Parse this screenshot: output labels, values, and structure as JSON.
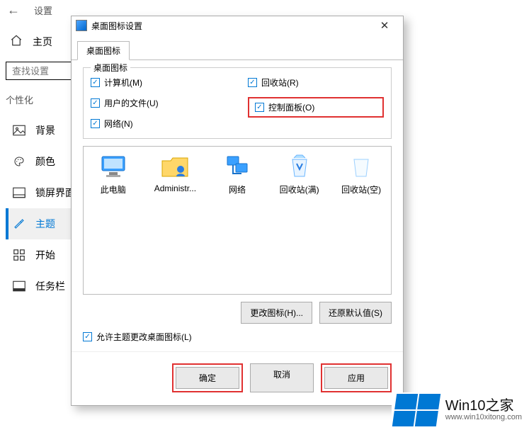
{
  "settings": {
    "header_label": "设置",
    "home_label": "主页",
    "search_placeholder": "查找设置",
    "section_title": "个性化",
    "nav": [
      {
        "key": "background",
        "label": "背景"
      },
      {
        "key": "color",
        "label": "颜色"
      },
      {
        "key": "lockscreen",
        "label": "锁屏界面"
      },
      {
        "key": "theme",
        "label": "主题",
        "active": true
      },
      {
        "key": "start",
        "label": "开始"
      },
      {
        "key": "taskbar",
        "label": "任务栏"
      }
    ]
  },
  "dialog": {
    "title": "桌面图标设置",
    "tab_label": "桌面图标",
    "group_title": "桌面图标",
    "checkboxes": {
      "computer": "计算机(M)",
      "recycle": "回收站(R)",
      "userfiles": "用户的文件(U)",
      "controlpanel": "控制面板(O)",
      "network": "网络(N)"
    },
    "icons": [
      {
        "key": "thispc",
        "label": "此电脑"
      },
      {
        "key": "admin",
        "label": "Administr..."
      },
      {
        "key": "network",
        "label": "网络"
      },
      {
        "key": "recycle_full",
        "label": "回收站(满)"
      },
      {
        "key": "recycle_empty",
        "label": "回收站(空)"
      }
    ],
    "change_icon_btn": "更改图标(H)...",
    "restore_btn": "还原默认值(S)",
    "allow_theme_label": "允许主题更改桌面图标(L)",
    "ok_btn": "确定",
    "cancel_btn": "取消",
    "apply_btn": "应用"
  },
  "watermark": {
    "brand": "Win10之家",
    "url": "www.win10xitong.com"
  }
}
